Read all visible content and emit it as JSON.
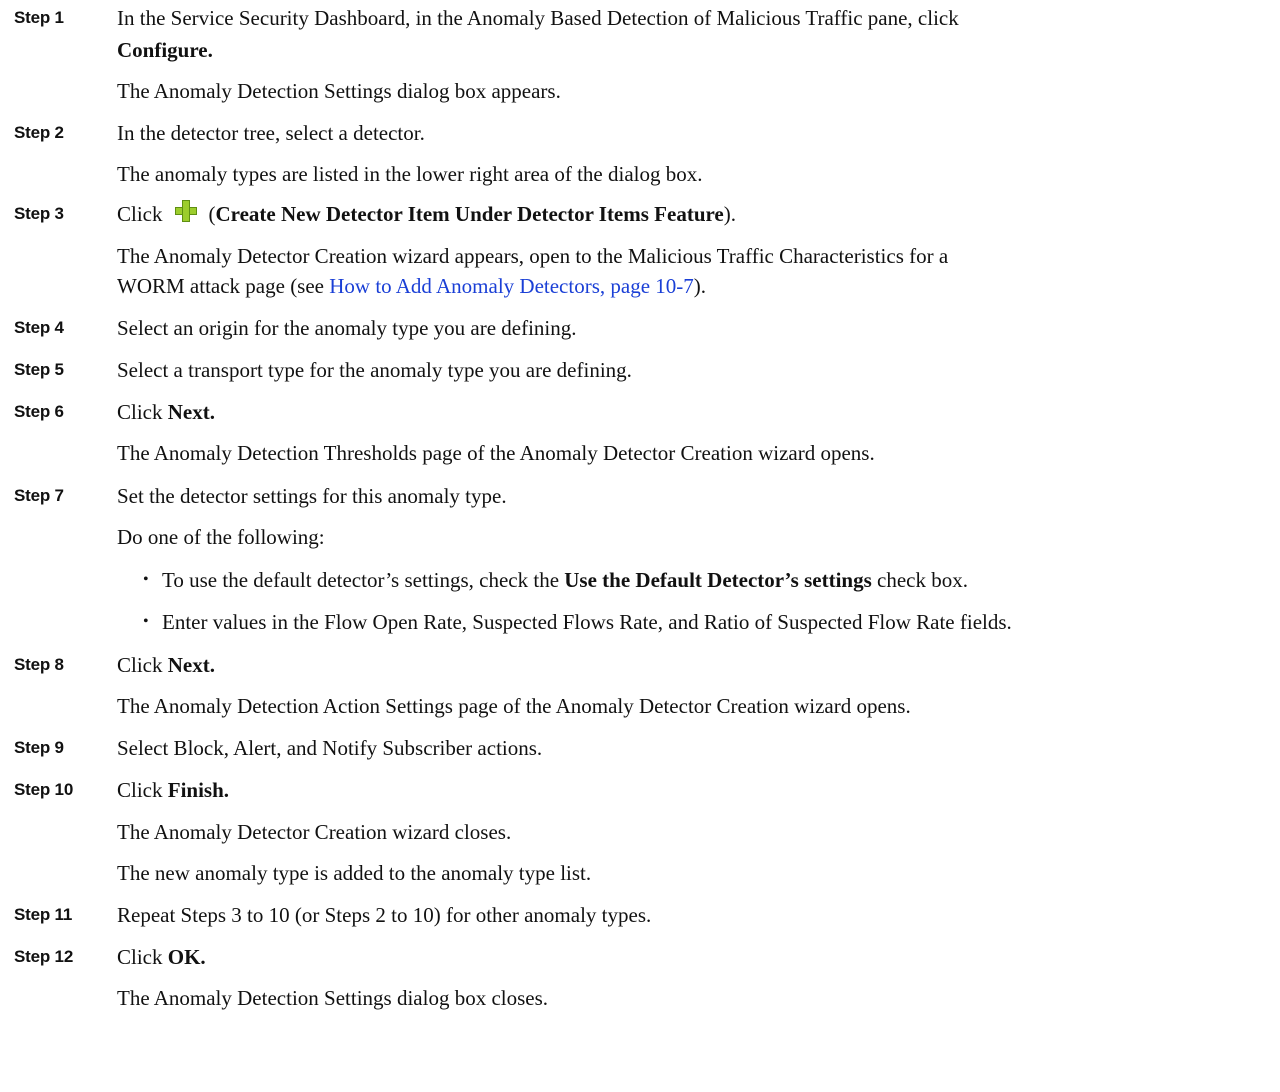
{
  "steps": [
    {
      "label": "Step 1",
      "line1": "In the Service Security Dashboard, in the Anomaly Based Detection of Malicious Traffic pane, click",
      "line2_bold": "Configure.",
      "result": "The Anomaly Detection Settings dialog box appears."
    },
    {
      "label": "Step 2",
      "text": "In the detector tree, select a detector.",
      "result": "The anomaly types are listed in the lower right area of the dialog box."
    },
    {
      "label": "Step 3",
      "click": "Click",
      "icon": "add-plus-icon",
      "paren_open": "(",
      "bold": "Create New Detector Item Under Detector Items Feature",
      "paren_close": ").",
      "result_line1": "The Anomaly Detector Creation wizard appears, open to the Malicious Traffic Characteristics for a",
      "result_line2_pre": "WORM attack page (see ",
      "result_link": "How to Add Anomaly Detectors, page 10-7",
      "result_line2_post": ")."
    },
    {
      "label": "Step 4",
      "text": "Select an origin for the anomaly type you are defining."
    },
    {
      "label": "Step 5",
      "text": "Select a transport type for the anomaly type you are defining."
    },
    {
      "label": "Step 6",
      "click": "Click",
      "bold": "Next.",
      "result": "The Anomaly Detection Thresholds page of the Anomaly Detector Creation wizard opens."
    },
    {
      "label": "Step 7",
      "text": "Set the detector settings for this anomaly type.",
      "intro": "Do one of the following:",
      "bullet": "•",
      "bullet1_pre": "To use the default detector’s settings, check the",
      "bullet1_bold": "Use the Default Detector’s settings",
      "bullet1_post": "check box.",
      "bullet2": "Enter values in the Flow Open Rate, Suspected Flows Rate, and Ratio of Suspected Flow Rate fields."
    },
    {
      "label": "Step 8",
      "click": "Click",
      "bold": "Next.",
      "result": "The Anomaly Detection Action Settings page of the Anomaly Detector Creation wizard opens."
    },
    {
      "label": "Step 9",
      "text": "Select Block, Alert, and Notify Subscriber actions."
    },
    {
      "label": "Step 10",
      "click": "Click",
      "bold": "Finish.",
      "result1": "The Anomaly Detector Creation wizard closes.",
      "result2": "The new anomaly type is added to the anomaly type list."
    },
    {
      "label": "Step 11",
      "text": "Repeat Steps 3 to 10 (or Steps 2 to 10) for other anomaly types."
    },
    {
      "label": "Step 12",
      "click": "Click",
      "bold": "OK.",
      "result": "The Anomaly Detection Settings dialog box closes."
    }
  ],
  "colors": {
    "link": "#1a3fd6",
    "plus_icon": "#9ccd2c"
  }
}
